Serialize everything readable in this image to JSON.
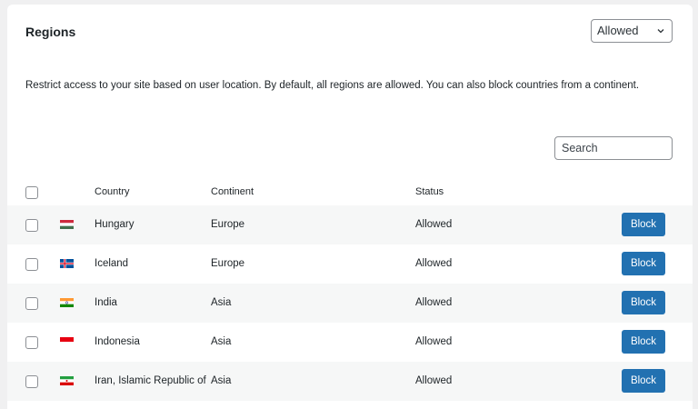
{
  "header": {
    "title": "Regions",
    "filter_select": {
      "value": "Allowed"
    }
  },
  "description": "Restrict access to your site based on user location. By default, all regions are allowed. You can also block countries from a continent.",
  "search": {
    "placeholder": "Search"
  },
  "table": {
    "columns": [
      "Country",
      "Continent",
      "Status"
    ],
    "rows": [
      {
        "flag": "hungary-flag",
        "country": "Hungary",
        "continent": "Europe",
        "status": "Allowed",
        "action": "Block"
      },
      {
        "flag": "iceland-flag",
        "country": "Iceland",
        "continent": "Europe",
        "status": "Allowed",
        "action": "Block"
      },
      {
        "flag": "india-flag",
        "country": "India",
        "continent": "Asia",
        "status": "Allowed",
        "action": "Block"
      },
      {
        "flag": "indonesia-flag",
        "country": "Indonesia",
        "continent": "Asia",
        "status": "Allowed",
        "action": "Block"
      },
      {
        "flag": "iran-flag",
        "country": "Iran, Islamic Republic of",
        "continent": "Asia",
        "status": "Allowed",
        "action": "Block"
      }
    ]
  },
  "colors": {
    "accent": "#2271b1",
    "stripe": "#f6f7f7",
    "background": "#f0f0f1"
  }
}
